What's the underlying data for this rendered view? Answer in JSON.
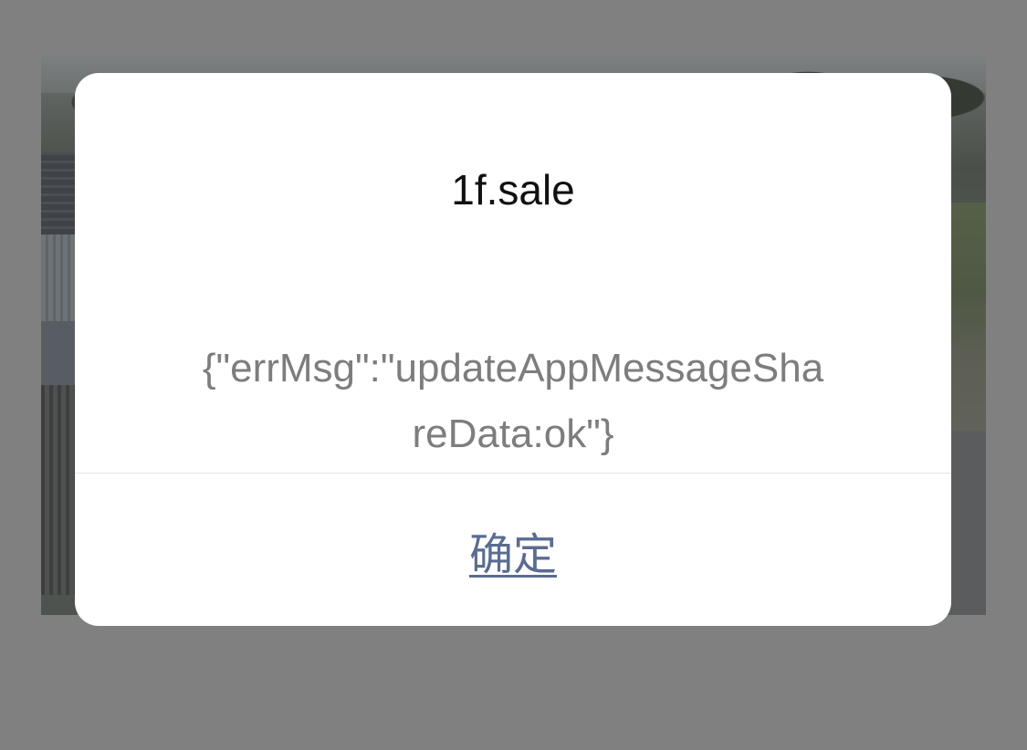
{
  "dialog": {
    "title": "1f.sale",
    "message_line1": "{\"errMsg\":\"updateAppMessageSha",
    "message_line2": "reData:ok\"}",
    "confirm_label": "确定"
  },
  "colors": {
    "overlay": "#808080",
    "dialog_background": "#ffffff",
    "title_text": "#111111",
    "message_text": "#7d7d7d",
    "button_text": "#5a6c91",
    "divider": "#e3e3e3"
  }
}
